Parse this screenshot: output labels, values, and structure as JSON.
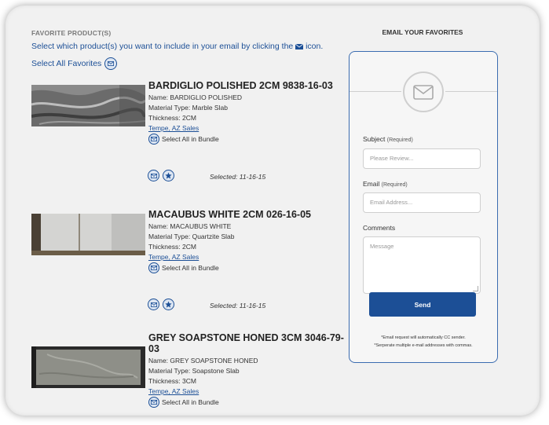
{
  "left": {
    "section_title": "FAVORITE PRODUCT(S)",
    "instructions_before": "Select which product(s) you want to include in your email by clicking the",
    "instructions_after": "icon.",
    "select_all": "Select All Favorites"
  },
  "products": [
    {
      "title": "BARDIGLIO POLISHED 2CM 9838-16-03",
      "name": "Name: BARDIGLIO POLISHED",
      "material": "Material Type: Marble Slab",
      "thickness": "Thickness: 2CM",
      "location": "Tempe, AZ Sales",
      "bundle": "Select All in Bundle",
      "selected": "Selected: 11-16-15"
    },
    {
      "title": "MACAUBUS WHITE 2CM 026-16-05",
      "name": "Name: MACAUBUS WHITE",
      "material": "Material Type: Quartzite Slab",
      "thickness": "Thickness: 2CM",
      "location": "Tempe, AZ Sales",
      "bundle": "Select All in Bundle",
      "selected": "Selected: 11-16-15"
    },
    {
      "title": "GREY SOAPSTONE HONED 3CM 3046-79-03",
      "name": "Name: GREY SOAPSTONE HONED",
      "material": "Material Type: Soapstone Slab",
      "thickness": "Thickness: 3CM",
      "location": "Tempe, AZ Sales",
      "bundle": "Select All in Bundle"
    }
  ],
  "email": {
    "title": "EMAIL YOUR FAVORITES",
    "subject_label": "Subject",
    "subject_req": "(Required)",
    "subject_placeholder": "Please Review...",
    "email_label": "Email",
    "email_req": "(Required)",
    "email_placeholder": "Email Address...",
    "comments_label": "Comments",
    "comments_placeholder": "Message",
    "send_label": "Send",
    "note1": "*Email request will automatically CC sender.",
    "note2": "*Serperate multiple e-mail addresses with commas."
  },
  "colors": {
    "accent": "#1c4f96",
    "background": "#f1f1f1"
  },
  "icons": [
    "envelope-icon",
    "star-icon",
    "mail-large-icon"
  ]
}
